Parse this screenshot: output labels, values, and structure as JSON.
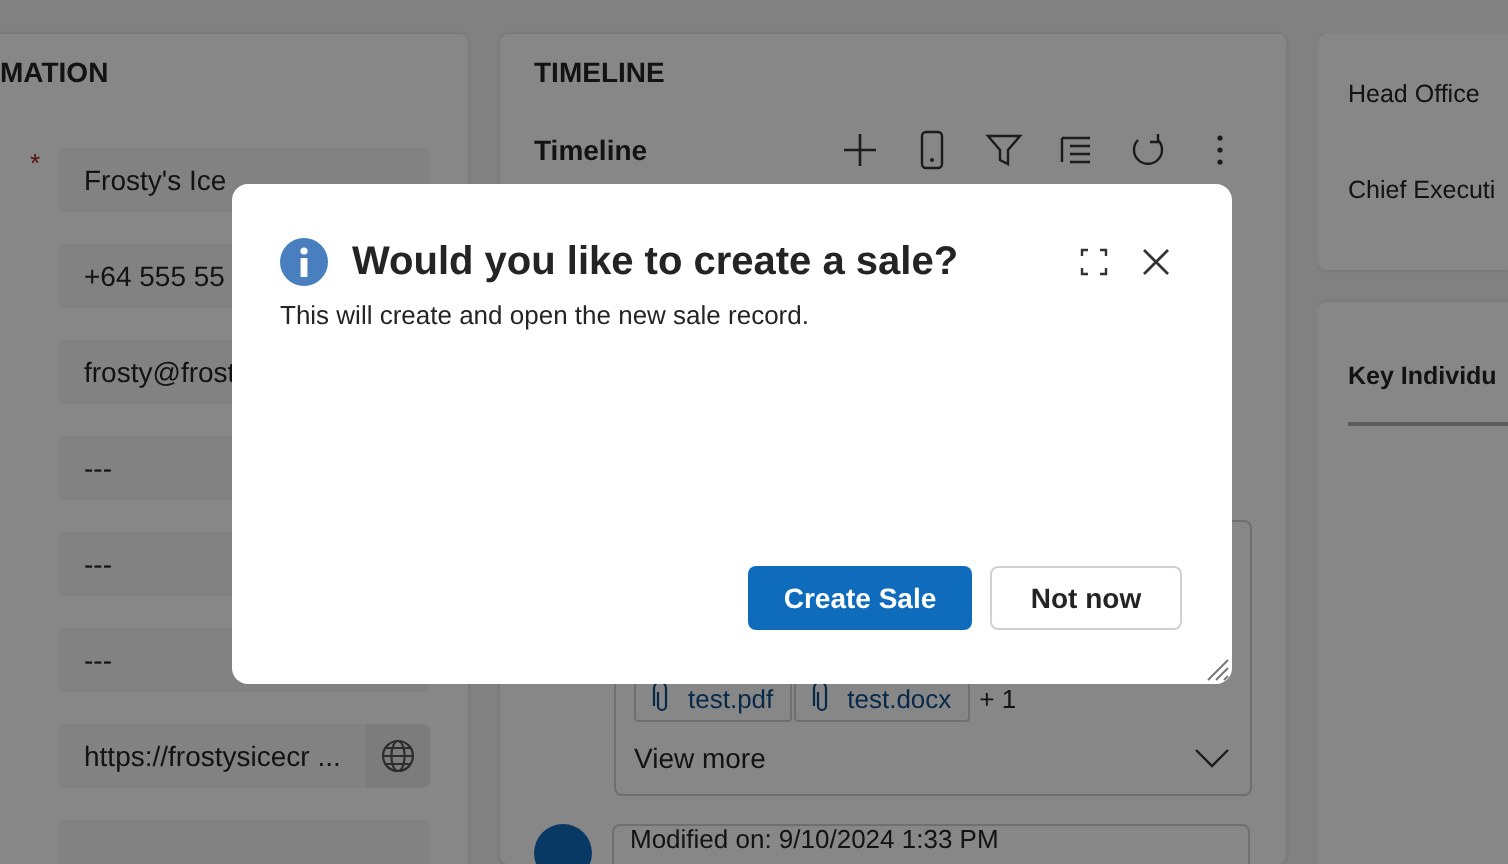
{
  "details_panel": {
    "heading": "MATION",
    "required_marker": "*",
    "fields": [
      {
        "kind": "text",
        "value": "Frosty's Ice",
        "required": true
      },
      {
        "kind": "text",
        "value": "+64 555 55",
        "required": false
      },
      {
        "kind": "text",
        "value": "frosty@frost",
        "required": false
      },
      {
        "kind": "text",
        "value": "---",
        "required": false
      },
      {
        "kind": "text",
        "value": "---",
        "required": false
      },
      {
        "kind": "text",
        "value": "---",
        "required": false
      },
      {
        "kind": "url",
        "value": "https://frostysicecr ...",
        "required": false
      },
      {
        "kind": "blank",
        "required": false
      }
    ]
  },
  "timeline": {
    "heading": "TIMELINE",
    "title": "Timeline",
    "attachments": [
      "test.pdf",
      "test.docx"
    ],
    "more_count": "+ 1",
    "view_more": "View more",
    "entry": "Modified on: 9/10/2024 1:33 PM"
  },
  "side_panel": {
    "fields": [
      "Head Office",
      "Chief Executi"
    ],
    "section": "Key Individu"
  },
  "dialog": {
    "title": "Would you like to create a sale?",
    "message": "This will create and open the new sale record.",
    "buttons": [
      {
        "label": "Create Sale",
        "kind": "primary"
      },
      {
        "label": "Not now",
        "kind": "secondary"
      }
    ]
  }
}
